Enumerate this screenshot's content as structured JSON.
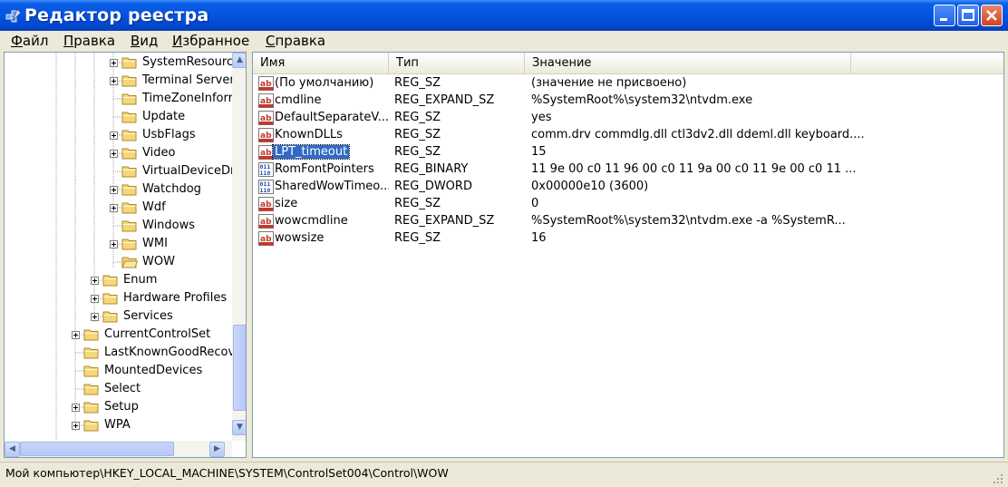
{
  "window": {
    "title": "Редактор реестра"
  },
  "menu": [
    {
      "label": "Файл",
      "accel": "Ф",
      "rest": "айл"
    },
    {
      "label": "Правка",
      "accel": "П",
      "rest": "равка"
    },
    {
      "label": "Вид",
      "accel": "В",
      "rest": "ид"
    },
    {
      "label": "Избранное",
      "accel": "И",
      "rest": "збранное"
    },
    {
      "label": "Справка",
      "accel": "С",
      "rest": "правка"
    }
  ],
  "tree": [
    {
      "label": "SystemResourc",
      "level": 3,
      "expandable": true
    },
    {
      "label": "Terminal Server",
      "level": 3,
      "expandable": true
    },
    {
      "label": "TimeZoneInforr",
      "level": 3,
      "expandable": false
    },
    {
      "label": "Update",
      "level": 3,
      "expandable": false
    },
    {
      "label": "UsbFlags",
      "level": 3,
      "expandable": true
    },
    {
      "label": "Video",
      "level": 3,
      "expandable": true
    },
    {
      "label": "VirtualDeviceDr",
      "level": 3,
      "expandable": false
    },
    {
      "label": "Watchdog",
      "level": 3,
      "expandable": true
    },
    {
      "label": "Wdf",
      "level": 3,
      "expandable": true
    },
    {
      "label": "Windows",
      "level": 3,
      "expandable": false
    },
    {
      "label": "WMI",
      "level": 3,
      "expandable": true
    },
    {
      "label": "WOW",
      "level": 3,
      "expandable": false,
      "open": true
    },
    {
      "label": "Enum",
      "level": 2,
      "expandable": true
    },
    {
      "label": "Hardware Profiles",
      "level": 2,
      "expandable": true
    },
    {
      "label": "Services",
      "level": 2,
      "expandable": true
    },
    {
      "label": "CurrentControlSet",
      "level": 1,
      "expandable": true
    },
    {
      "label": "LastKnownGoodRecov",
      "level": 1,
      "expandable": false
    },
    {
      "label": "MountedDevices",
      "level": 1,
      "expandable": false
    },
    {
      "label": "Select",
      "level": 1,
      "expandable": false
    },
    {
      "label": "Setup",
      "level": 1,
      "expandable": true
    },
    {
      "label": "WPA",
      "level": 1,
      "expandable": true
    }
  ],
  "columns": [
    "Имя",
    "Тип",
    "Значение"
  ],
  "values": [
    {
      "name": "(По умолчанию)",
      "type": "REG_SZ",
      "data": "(значение не присвоено)",
      "icon": "string-value-icon"
    },
    {
      "name": "cmdline",
      "type": "REG_EXPAND_SZ",
      "data": "%SystemRoot%\\system32\\ntvdm.exe",
      "icon": "string-value-icon"
    },
    {
      "name": "DefaultSeparateV...",
      "type": "REG_SZ",
      "data": "yes",
      "icon": "string-value-icon"
    },
    {
      "name": "KnownDLLs",
      "type": "REG_SZ",
      "data": "comm.drv commdlg.dll ctl3dv2.dll ddeml.dll keyboard....",
      "icon": "string-value-icon"
    },
    {
      "name": "LPT_timeout",
      "type": "REG_SZ",
      "data": "15",
      "icon": "string-value-icon",
      "selected": true
    },
    {
      "name": "RomFontPointers",
      "type": "REG_BINARY",
      "data": "11 9e 00 c0 11 96 00 c0 11 9a 00 c0 11 9e 00 c0 11 ...",
      "icon": "binary-value-icon"
    },
    {
      "name": "SharedWowTimeo...",
      "type": "REG_DWORD",
      "data": "0x00000e10 (3600)",
      "icon": "binary-value-icon"
    },
    {
      "name": "size",
      "type": "REG_SZ",
      "data": "0",
      "icon": "string-value-icon"
    },
    {
      "name": "wowcmdline",
      "type": "REG_EXPAND_SZ",
      "data": "%SystemRoot%\\system32\\ntvdm.exe -a %SystemR...",
      "icon": "string-value-icon"
    },
    {
      "name": "wowsize",
      "type": "REG_SZ",
      "data": "16",
      "icon": "string-value-icon"
    }
  ],
  "status": {
    "path": "Мой компьютер\\HKEY_LOCAL_MACHINE\\SYSTEM\\ControlSet004\\Control\\WOW"
  }
}
